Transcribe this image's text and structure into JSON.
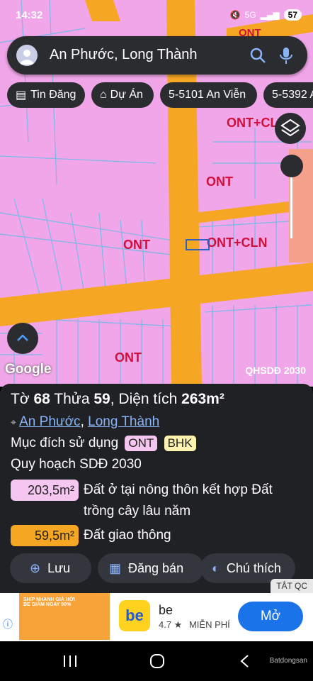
{
  "status": {
    "time": "14:32",
    "signal": "5G",
    "battery": "57"
  },
  "search": {
    "text": "An Phước, Long Thành"
  },
  "chips": [
    {
      "label": "Tin Đăng",
      "icon": "newspaper-icon"
    },
    {
      "label": "Dự Án",
      "icon": "building-icon"
    },
    {
      "label": "5-5101 An Viễn"
    },
    {
      "label": "5-5392 An"
    }
  ],
  "map": {
    "labels": [
      "ONT",
      "ONT+CL",
      "ONT",
      "ONT",
      "ONT+CLN",
      "ONT"
    ],
    "google": "Google",
    "layer_name": "QHSDĐ 2030",
    "colors": {
      "land": "#f0a6e8",
      "road": "#f5a623",
      "parcel_line": "#7ab8e8"
    }
  },
  "panel": {
    "title_prefix": "Tờ",
    "sheet": "68",
    "plot_label": "Thửa",
    "plot": "59",
    "area_label": ", Diện tích",
    "area": "263m²",
    "commune": "An Phước",
    "district": "Long Thành",
    "purpose_label": "Mục đích sử dụng",
    "purpose_tags": [
      "ONT",
      "BHK"
    ],
    "plan_label": "Quy hoạch SDĐ 2030",
    "areas": [
      {
        "value": "203,5m²",
        "desc": "Đất ở tại nông thôn kết hợp Đất trồng cây lâu năm",
        "color": "#f5c6f0"
      },
      {
        "value": "59,5m²",
        "desc": "Đất giao thông",
        "color": "#f5a623"
      }
    ],
    "buttons": [
      "Lưu",
      "Đăng bán",
      "Chú thích"
    ]
  },
  "ad": {
    "close_label": "TẮT QC",
    "app_name": "be",
    "logo_text": "be",
    "rating": "4.7 ★",
    "price": "MIỄN PHÍ",
    "cta": "Mở",
    "banner_text": "SHIP NHANH GIÁ HỜI BE GIẢM NGAY 50%"
  },
  "watermark": "Batdongsan"
}
